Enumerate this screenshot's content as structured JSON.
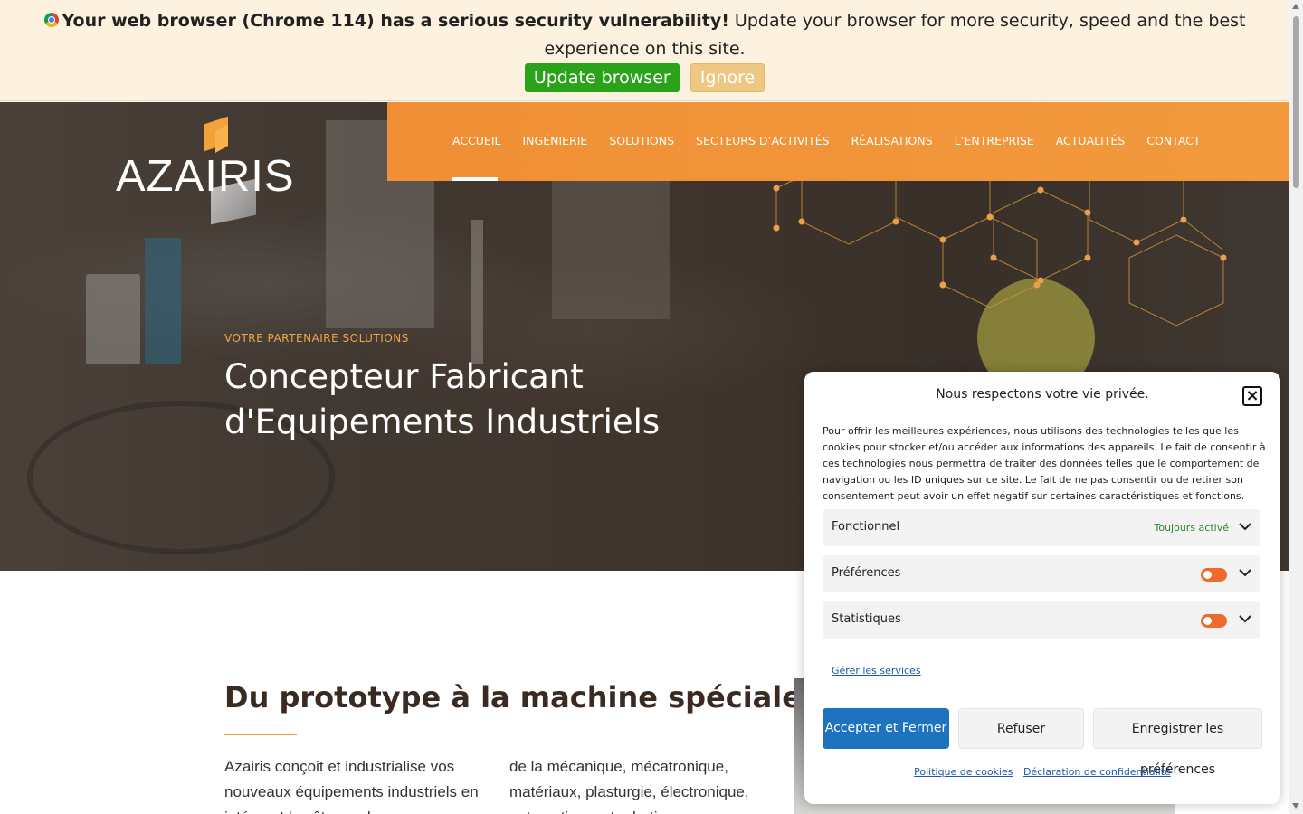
{
  "update_bar": {
    "warning": "Your web browser (Chrome 114) has a serious security vulnerability!",
    "message": "Update your browser for more security, speed and the best experience on this site.",
    "update_label": "Update browser",
    "ignore_label": "Ignore"
  },
  "logo": {
    "text": "AZAIRIS"
  },
  "nav": {
    "items": [
      {
        "label": "ACCUEIL"
      },
      {
        "label": "INGÉNIERIE"
      },
      {
        "label": "SOLUTIONS"
      },
      {
        "label": "SECTEURS D’ACTIVITÉS"
      },
      {
        "label": "RÉALISATIONS"
      },
      {
        "label": "L’ENTREPRISE"
      },
      {
        "label": "ACTUALITÉS"
      },
      {
        "label": "CONTACT"
      }
    ],
    "active_index": 0
  },
  "hero": {
    "kicker": "VOTRE PARTENAIRE SOLUTIONS",
    "title_line1": "Concepteur Fabricant",
    "title_line2": "d'Equipements Industriels"
  },
  "content": {
    "title": "Du prototype à la machine spéciale",
    "col1": "Azairis conçoit et industrialise vos nouveaux équipements industriels en intégrant les êtes au long",
    "col2": "de la mécanique, mécatronique, matériaux, plasturgie, électronique, automatisme et robotique..."
  },
  "cookie": {
    "title": "Nous respectons votre vie privée.",
    "description": "Pour offrir les meilleures expériences, nous utilisons des technologies telles que les cookies pour stocker et/ou accéder aux informations des appareils. Le fait de consentir à ces technologies nous permettra de traiter des données telles que le comportement de navigation ou les ID uniques sur ce site. Le fait de ne pas consentir ou de retirer son consentement peut avoir un effet négatif sur certaines caractéristiques et fonctions.",
    "categories": [
      {
        "name": "Fonctionnel",
        "status": "Toujours activé"
      },
      {
        "name": "Préférences",
        "toggle": true
      },
      {
        "name": "Statistiques",
        "toggle": true
      }
    ],
    "manage_label": "Gérer les services",
    "accept_label": "Accepter et Fermer",
    "refuse_label": "Refuser",
    "save_label": "Enregistrer les préférences",
    "links": [
      "Politique de cookies",
      "Déclaration de confidentialité"
    ],
    "accent_color": "#1e73be",
    "toggle_color": "#ef6b2b"
  },
  "colors": {
    "brand_orange": "#f08f35",
    "update_green": "#2aa31a"
  }
}
